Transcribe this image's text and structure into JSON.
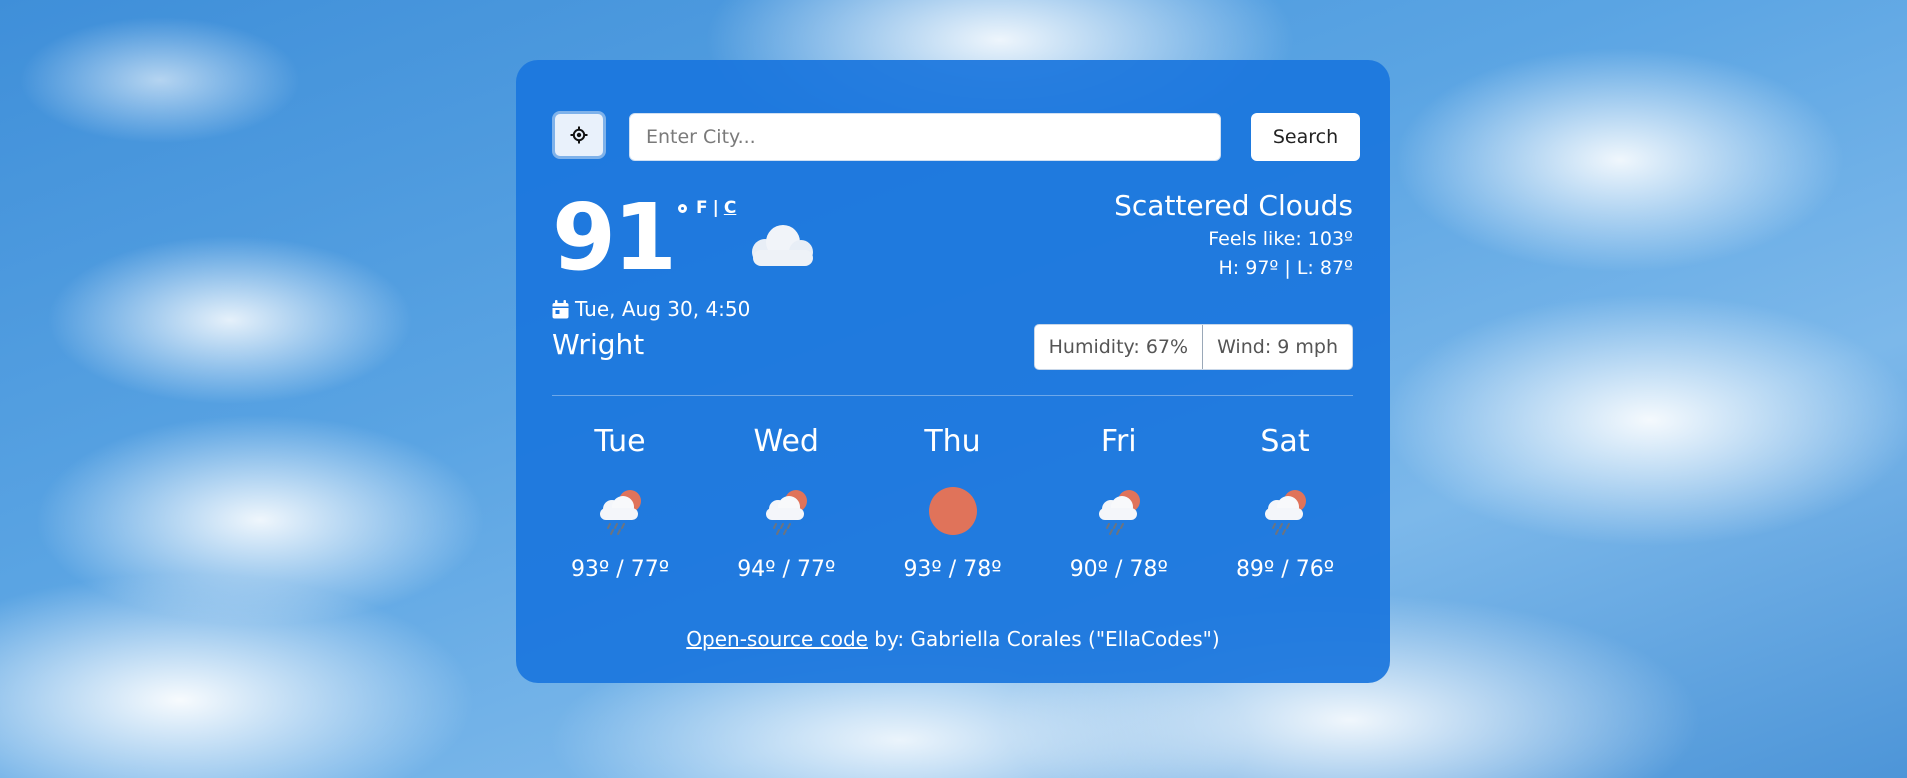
{
  "search": {
    "placeholder": "Enter City...",
    "button_label": "Search"
  },
  "current": {
    "temperature": "91",
    "unit_f": "F",
    "unit_sep": "|",
    "unit_c": "C",
    "icon": "cloud-icon",
    "date": "Tue, Aug 30, 4:50",
    "city": "Wright",
    "condition": "Scattered Clouds",
    "feels_like": "Feels like: 103º",
    "high_low": "H: 97º | L: 87º",
    "humidity": "Humidity: 67%",
    "wind": "Wind: 9 mph"
  },
  "forecast": [
    {
      "day": "Tue",
      "range": "93º / 77º",
      "icon": "rain-sun-cloud-icon"
    },
    {
      "day": "Wed",
      "range": "94º / 77º",
      "icon": "rain-sun-cloud-icon"
    },
    {
      "day": "Thu",
      "range": "93º / 78º",
      "icon": "sun-icon"
    },
    {
      "day": "Fri",
      "range": "90º / 78º",
      "icon": "rain-sun-cloud-icon"
    },
    {
      "day": "Sat",
      "range": "89º / 76º",
      "icon": "rain-sun-cloud-icon"
    }
  ],
  "footer": {
    "link_text": "Open-source code",
    "credit": " by: Gabriella Corales (\"EllaCodes\")"
  },
  "colors": {
    "card": "#1b76de",
    "sun": "#e0735a"
  }
}
